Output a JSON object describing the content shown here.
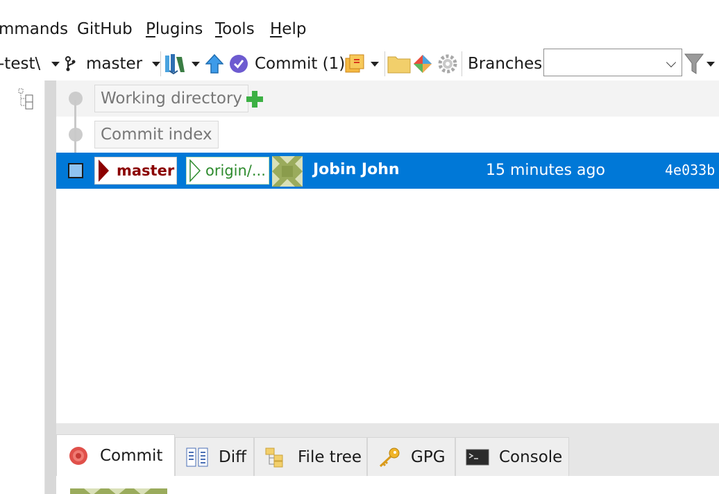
{
  "menu": {
    "items": [
      {
        "pre": "",
        "u": "",
        "rest": "mmands"
      },
      {
        "pre": "GitHub",
        "u": "",
        "rest": ""
      },
      {
        "pre": "",
        "u": "P",
        "rest": "lugins"
      },
      {
        "pre": "",
        "u": "T",
        "rest": "ools"
      },
      {
        "pre": "",
        "u": "H",
        "rest": "elp"
      }
    ]
  },
  "toolbar": {
    "repo_label": "-test\\",
    "branch_label": "master",
    "commit_label": "Commit (1)",
    "branches_label": "Branches:",
    "branches_value": ""
  },
  "graph": {
    "working_directory_label": "Working directory",
    "commit_index_label": "Commit index",
    "commits": [
      {
        "refs": [
          "master",
          "origin/..."
        ],
        "author": "Jobin John",
        "time": "15 minutes ago",
        "hash": "4e033b",
        "selected": true
      }
    ]
  },
  "tabs": [
    {
      "label": "Commit",
      "icon": "commit-icon",
      "active": true
    },
    {
      "label": "Diff",
      "icon": "diff-icon",
      "active": false
    },
    {
      "label": "File tree",
      "icon": "file-tree-icon",
      "active": false
    },
    {
      "label": "GPG",
      "icon": "key-icon",
      "active": false
    },
    {
      "label": "Console",
      "icon": "console-icon",
      "active": false
    }
  ],
  "colors": {
    "selection": "#0078d7",
    "master_ref": "#8b0000",
    "origin_ref": "#2e8b2e",
    "avatar": "#9aab5c"
  }
}
